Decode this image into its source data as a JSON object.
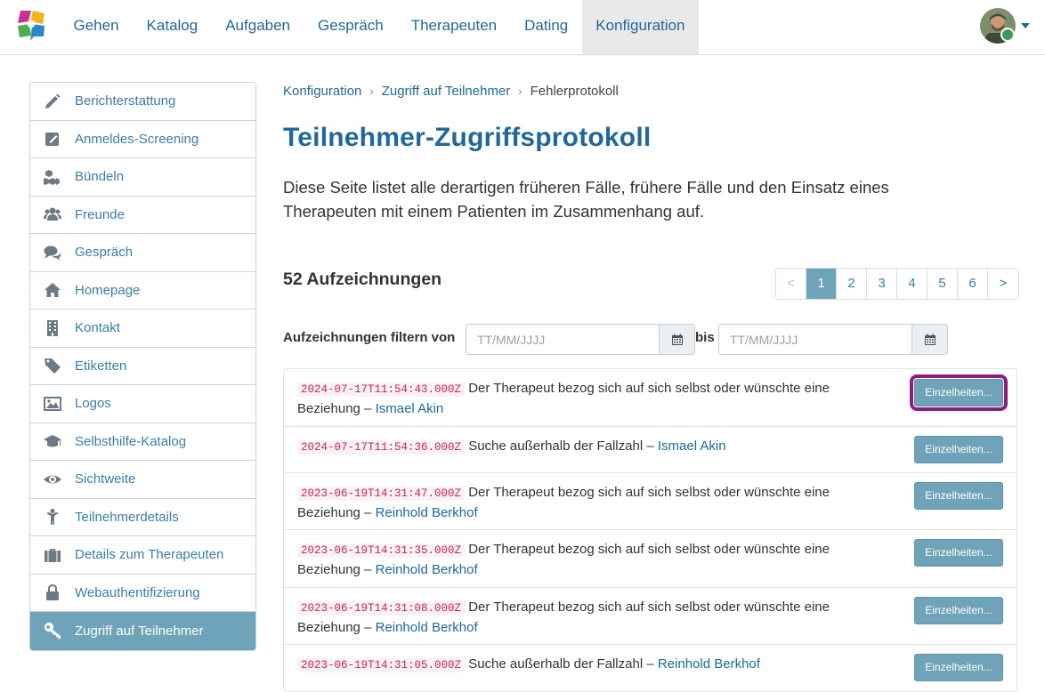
{
  "nav": {
    "items": [
      {
        "label": "Gehen"
      },
      {
        "label": "Katalog"
      },
      {
        "label": "Aufgaben"
      },
      {
        "label": "Gespräch"
      },
      {
        "label": "Therapeuten"
      },
      {
        "label": "Dating"
      },
      {
        "label": "Konfiguration",
        "active": true
      }
    ]
  },
  "sidebar": {
    "items": [
      {
        "label": "Berichterstattung",
        "icon": "pencil-icon"
      },
      {
        "label": "Anmeldes-Screening",
        "icon": "edit-square-icon"
      },
      {
        "label": "Bündeln",
        "icon": "cubes-icon"
      },
      {
        "label": "Freunde",
        "icon": "users-icon"
      },
      {
        "label": "Gespräch",
        "icon": "comments-icon"
      },
      {
        "label": "Homepage",
        "icon": "home-icon"
      },
      {
        "label": "Kontakt",
        "icon": "building-icon"
      },
      {
        "label": "Etiketten",
        "icon": "tag-icon"
      },
      {
        "label": "Logos",
        "icon": "image-icon"
      },
      {
        "label": "Selbsthilfe-Katalog",
        "icon": "graduation-cap-icon"
      },
      {
        "label": "Sichtweite",
        "icon": "eye-icon"
      },
      {
        "label": "Teilnehmerdetails",
        "icon": "person-icon"
      },
      {
        "label": "Details zum Therapeuten",
        "icon": "briefcase-icon"
      },
      {
        "label": "Webauthentifizierung",
        "icon": "lock-icon"
      },
      {
        "label": "Zugriff auf Teilnehmer",
        "icon": "key-icon",
        "active": true
      }
    ]
  },
  "breadcrumb": {
    "items": [
      "Konfiguration",
      "Zugriff auf Teilnehmer"
    ],
    "current": "Fehlerprotokoll"
  },
  "page": {
    "title": "Teilnehmer-Zugriffsprotokoll",
    "intro": "Diese Seite listet alle derartigen früheren Fälle, frühere Fälle und den Einsatz eines Therapeuten mit einem Patienten im Zusammenhang auf.",
    "count": "52 Aufzeichnungen"
  },
  "pagination": {
    "prev": "<",
    "next": ">",
    "pages": [
      "1",
      "2",
      "3",
      "4",
      "5",
      "6"
    ],
    "current": "1"
  },
  "filter": {
    "label": "Aufzeichnungen filtern von",
    "to_label": "bis",
    "from_placeholder": "TT/MM/JJJJ",
    "to_placeholder": "TT/MM/JJJJ"
  },
  "records": [
    {
      "timestamp": "2024-07-17T11:54:43.000Z",
      "text": "Der Therapeut bezog sich auf sich selbst oder wünschte eine Beziehung –",
      "person": "Ismael Akin",
      "button": "Einzelheiten...",
      "highlighted": true
    },
    {
      "timestamp": "2024-07-17T11:54:36.000Z",
      "text": "Suche außerhalb der Fallzahl –",
      "person": "Ismael Akin",
      "button": "Einzelheiten..."
    },
    {
      "timestamp": "2023-06-19T14:31:47.000Z",
      "text": "Der Therapeut bezog sich auf sich selbst oder wünschte eine Beziehung –",
      "person": "Reinhold Berkhof",
      "button": "Einzelheiten..."
    },
    {
      "timestamp": "2023-06-19T14:31:35.000Z",
      "text": "Der Therapeut bezog sich auf sich selbst oder wünschte eine Beziehung –",
      "person": "Reinhold Berkhof",
      "button": "Einzelheiten..."
    },
    {
      "timestamp": "2023-06-19T14:31:08.000Z",
      "text": "Der Therapeut bezog sich auf sich selbst oder wünschte eine Beziehung –",
      "person": "Reinhold Berkhof",
      "button": "Einzelheiten..."
    },
    {
      "timestamp": "2023-06-19T14:31:05.000Z",
      "text": "Suche außerhalb der Fallzahl –",
      "person": "Reinhold Berkhof",
      "button": "Einzelheiten..."
    }
  ],
  "colors": {
    "brand_blue": "#1f6899",
    "accent_teal": "#6fa3b9",
    "highlight": "#8b1e7e"
  }
}
